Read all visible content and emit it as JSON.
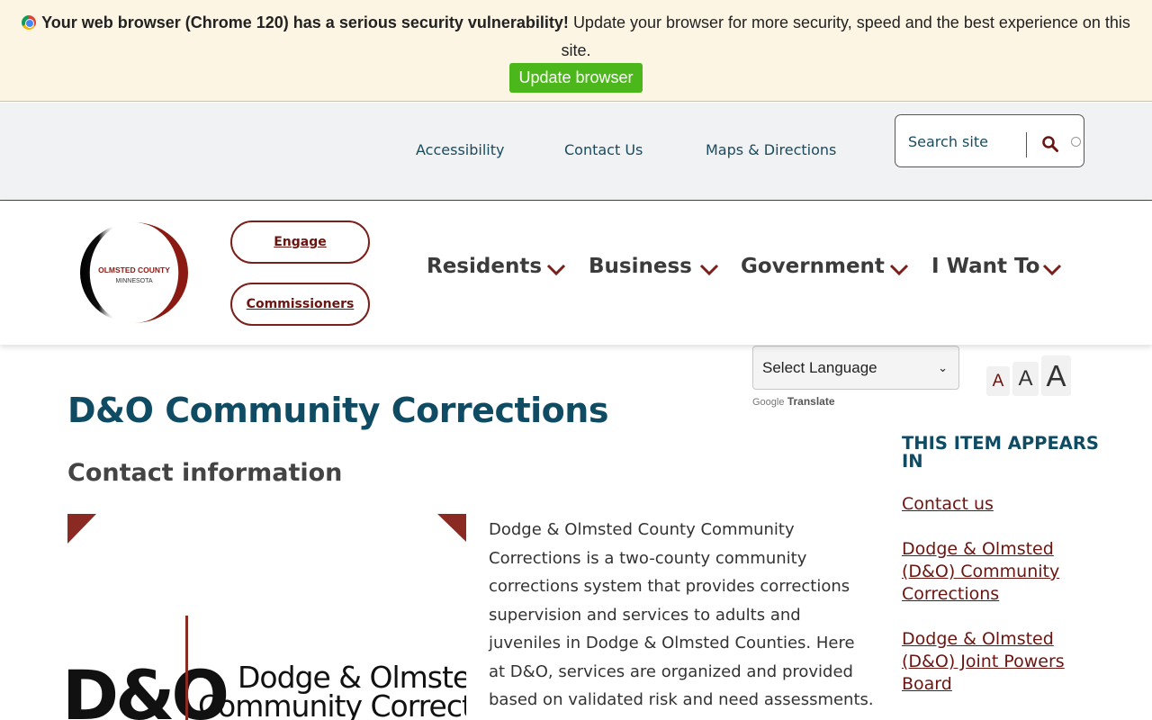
{
  "banner": {
    "browser_warning": "Your web browser (Chrome 120) has a serious security vulnerability!",
    "message": "Update your browser for more security, speed and the best experience on this site.",
    "update_button": "Update browser"
  },
  "utility_nav": {
    "links": [
      "Accessibility",
      "Contact Us",
      "Maps & Directions"
    ],
    "search_placeholder": "Search site"
  },
  "header": {
    "logo": {
      "line1": "OLMSTED COUNTY",
      "line2": "MINNESOTA"
    },
    "pill_buttons": [
      "Engage",
      "Commissioners"
    ],
    "main_nav": [
      "Residents",
      "Business",
      "Government",
      "I Want To"
    ]
  },
  "language": {
    "select_label": "Select Language",
    "google_word": "Google",
    "translate_word": "Translate"
  },
  "font_sizes": [
    "A",
    "A",
    "A"
  ],
  "content": {
    "title": "D&O Community Corrections",
    "section_heading": "Contact information",
    "image": {
      "mark": "D&O",
      "name_line1": "Dodge & Olmsted",
      "name_line2": "Community Corrections"
    },
    "description": "Dodge & Olmsted County Community Corrections is a two-county community corrections system that provides corrections supervision and services to adults and juveniles in Dodge & Olmsted Counties. Here at D&O, services are organized and provided based on validated risk and need assessments."
  },
  "sidebar": {
    "heading": "THIS ITEM APPEARS IN",
    "links": [
      "Contact us",
      "Dodge & Olmsted (D&O) Community Corrections",
      "Dodge & Olmsted (D&O) Joint Powers Board"
    ]
  },
  "colors": {
    "brand_maroon": "#7a1f1a",
    "heading_teal": "#0f4c63",
    "update_green": "#4cb71a",
    "banner_bg": "#fdf5e4"
  }
}
